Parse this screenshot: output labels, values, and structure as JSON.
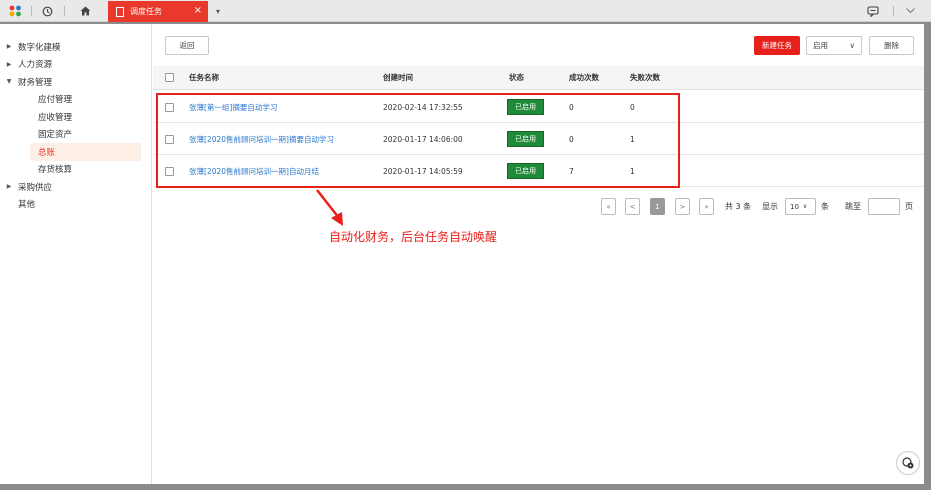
{
  "tabs": {
    "active_title": "调度任务",
    "close": "×",
    "dropdown": "▾"
  },
  "icons": {
    "apps": "apps-icon",
    "history": "history-icon",
    "home": "home-icon",
    "message": "message-icon",
    "expand": "chevron-down-icon"
  },
  "colors": {
    "accent": "#e8201b",
    "status": "#1f8a3a",
    "link": "#2b78d1"
  },
  "sidebar": {
    "items": [
      {
        "label": "数字化建模",
        "arrow": "▶"
      },
      {
        "label": "人力资源",
        "arrow": "▶"
      },
      {
        "label": "财务管理",
        "arrow": "▼"
      },
      {
        "label": "应付管理"
      },
      {
        "label": "应收管理"
      },
      {
        "label": "固定资产"
      },
      {
        "label": "总账"
      },
      {
        "label": "存货核算"
      },
      {
        "label": "采购供应",
        "arrow": "▶"
      },
      {
        "label": "其他"
      }
    ]
  },
  "toolbar": {
    "back": "返回",
    "new_task": "新建任务",
    "enable_select": "启用",
    "enable_caret": "∨",
    "delete": "删除"
  },
  "table": {
    "columns": [
      "任务名称",
      "创建时间",
      "状态",
      "成功次数",
      "失败次数"
    ],
    "rows": [
      {
        "name": "张薄[第一组]摘要自动学习",
        "created": "2020-02-14 17:32:55",
        "status": "已启用",
        "success": "0",
        "fail": "0"
      },
      {
        "name": "张薄[2020售前顾问培训一期]摘要自动学习",
        "created": "2020-01-17 14:06:00",
        "status": "已启用",
        "success": "0",
        "fail": "1"
      },
      {
        "name": "张薄[2020售前顾问培训一期]自动月结",
        "created": "2020-01-17 14:05:59",
        "status": "已启用",
        "success": "7",
        "fail": "1"
      }
    ]
  },
  "annotation": "自动化财务，后台任务自动唤醒",
  "pager": {
    "first": "«",
    "prev": "<",
    "current": "1",
    "next": ">",
    "last": "»",
    "total": "共 3 条",
    "show": "显示",
    "page_size": "10",
    "size_caret": "∨",
    "unit": "条",
    "goto": "跳至",
    "page": "页"
  }
}
